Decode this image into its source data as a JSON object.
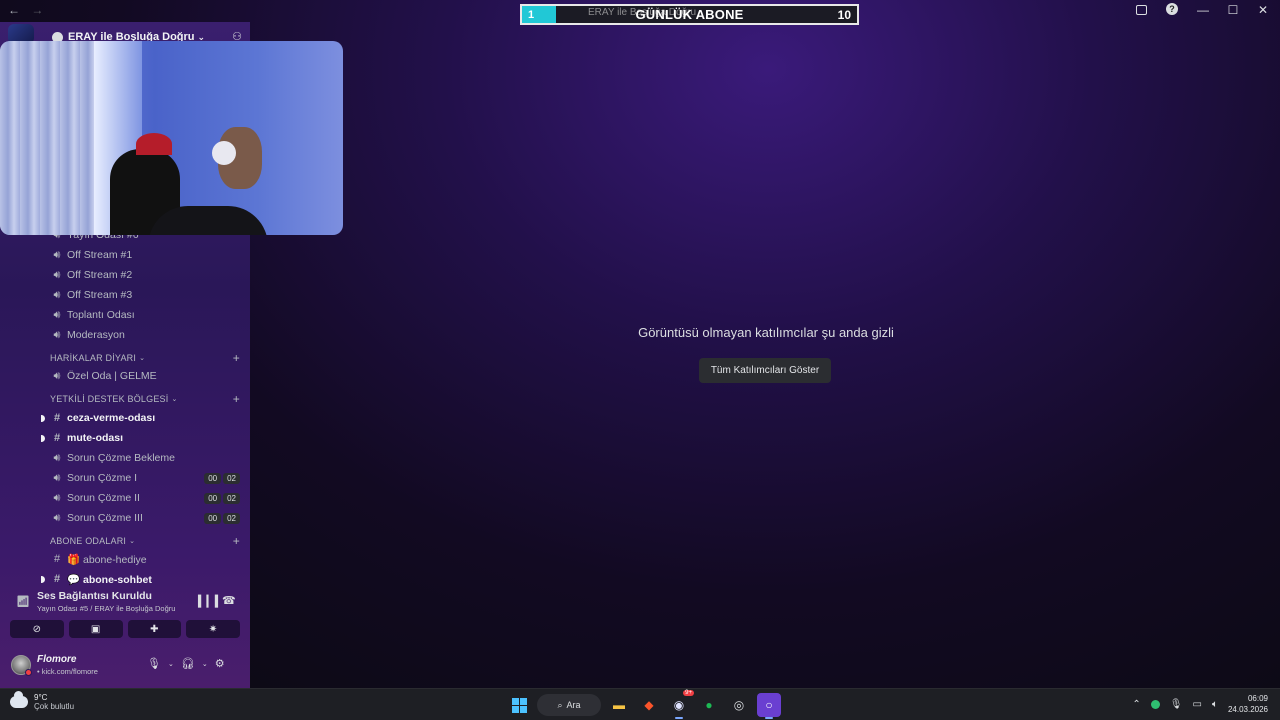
{
  "window": {
    "nav_back": "←",
    "nav_forward": "→"
  },
  "overlay": {
    "current": "1",
    "label": "GÜNLÜK ABONE",
    "goal": "10",
    "ghost_text": "ERAY ile Boşluğa Doğru",
    "progress": 0.1
  },
  "server": {
    "name": "ERAY ile Boşluğa Doğru"
  },
  "channels": {
    "partial": "Yayın Odası #6",
    "items": [
      {
        "label": "Off Stream #1",
        "icon": "speaker-icon"
      },
      {
        "label": "Off Stream #2",
        "icon": "speaker-icon"
      },
      {
        "label": "Off Stream #3",
        "icon": "speaker-icon"
      },
      {
        "label": "Toplantı Odası",
        "icon": "speaker-icon"
      },
      {
        "label": "Moderasyon",
        "icon": "speaker-icon"
      }
    ],
    "cat1": "HARİKALAR DİYARI",
    "cat1_items": [
      {
        "label": "Özel Oda | GELME",
        "icon": "speaker-icon"
      }
    ],
    "cat2": "YETKİLİ DESTEK BÖLGESİ",
    "cat2_items": [
      {
        "label": "ceza-verme-odası",
        "icon": "hash-icon"
      },
      {
        "label": "mute-odası",
        "icon": "hash-icon"
      },
      {
        "label": "Sorun Çözme Bekleme",
        "icon": "speaker-icon"
      },
      {
        "label": "Sorun Çözme I",
        "icon": "speaker-icon",
        "c1": "00",
        "c2": "02"
      },
      {
        "label": "Sorun Çözme II",
        "icon": "speaker-icon",
        "c1": "00",
        "c2": "02"
      },
      {
        "label": "Sorun Çözme III",
        "icon": "speaker-icon",
        "c1": "00",
        "c2": "02"
      }
    ],
    "cat3": "ABONE ODALARI",
    "cat3_items": [
      {
        "label": "🎁 abone-hediye",
        "icon": "hash-icon"
      },
      {
        "label": "💬 abone-sohbet",
        "icon": "hash-icon"
      }
    ]
  },
  "voice": {
    "status": "Ses Bağlantısı Kuruldu",
    "location": "Yayın Odası #5 / ERAY ile Boşluğa Doğru"
  },
  "user": {
    "name": "Flomore",
    "status": "• kick.com/flomore"
  },
  "stage": {
    "message": "Görüntüsü olmayan katılımcılar şu anda gizli",
    "button": "Tüm Katılımcıları Göster"
  },
  "taskbar": {
    "temp": "9°C",
    "condition": "Çok bulutlu",
    "search": "Ara",
    "discord_badge": "9+",
    "time": "06:09",
    "date": "24.03.2026"
  }
}
